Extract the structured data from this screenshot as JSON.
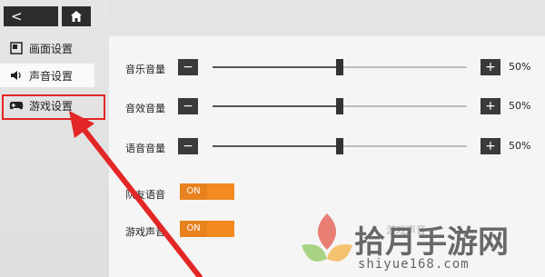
{
  "nav": {
    "back_icon": "<",
    "home": "home-icon"
  },
  "sidebar": {
    "items": [
      {
        "label": "画面设置",
        "icon": "display-icon"
      },
      {
        "label": "声音设置",
        "icon": "speaker-icon"
      },
      {
        "label": "游戏设置",
        "icon": "gamepad-icon"
      }
    ]
  },
  "sliders": [
    {
      "label": "音乐音量",
      "value_text": "50%",
      "level": 0.5
    },
    {
      "label": "音效音量",
      "value_text": "50%",
      "level": 0.5
    },
    {
      "label": "语音音量",
      "value_text": "50%",
      "level": 0.5
    }
  ],
  "toggles": [
    {
      "label": "队友语音",
      "state": "ON"
    },
    {
      "label": "游戏声音",
      "state": "ON"
    }
  ],
  "controls": {
    "minus": "−",
    "plus": "+"
  },
  "watermark": {
    "title": "拾月手游网",
    "url": "shiyue168.com",
    "faded": "游戏声音"
  },
  "colors": {
    "toggle_on": "#e8821e",
    "annotation_red": "#e32626"
  }
}
